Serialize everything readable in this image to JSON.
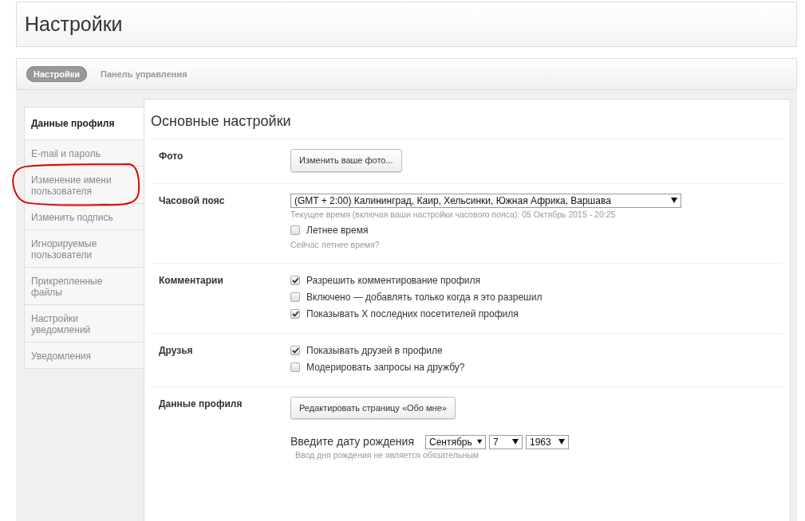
{
  "page_title": "Настройки",
  "tabs": [
    {
      "label": "Настройки",
      "selected": true
    },
    {
      "label": "Панель управления",
      "selected": false
    }
  ],
  "sidebar": {
    "items": [
      {
        "label": "Данные профиля",
        "selected": true
      },
      {
        "label": "E-mail и пароль",
        "selected": false
      },
      {
        "label": "Изменение имени пользователя",
        "selected": false,
        "circled": true
      },
      {
        "label": "Изменить подпись",
        "selected": false
      },
      {
        "label": "Игнорируемые пользователи",
        "selected": false
      },
      {
        "label": "Прикрепленные файлы",
        "selected": false
      },
      {
        "label": "Настройки уведомлений",
        "selected": false
      },
      {
        "label": "Уведомления",
        "selected": false
      }
    ]
  },
  "content": {
    "title": "Основные настройки",
    "sections": [
      {
        "label": "Фото",
        "controls": [
          {
            "kind": "button",
            "label": "Изменить ваше фото..."
          }
        ]
      },
      {
        "label": "Часовой пояс",
        "controls": [
          {
            "kind": "select",
            "value": "(GMT + 2:00) Калининград, Каир, Хельсинки, Южная Африка, Варшава"
          },
          {
            "kind": "hint",
            "text": "Текущее время (включая ваши настройки часового пояса): 05 Октябрь 2015 - 20:25"
          },
          {
            "kind": "checkbox",
            "label": "Летнее время",
            "checked": false
          },
          {
            "kind": "hint",
            "text": "Сейчас летнее время?"
          }
        ]
      },
      {
        "label": "Комментарии",
        "controls": [
          {
            "kind": "checkbox",
            "label": "Разрешить комментирование профиля",
            "checked": true
          },
          {
            "kind": "checkbox",
            "label": "Включено — добавлять только когда я это разрешил",
            "checked": false
          },
          {
            "kind": "checkbox",
            "label": "Показывать X последних посетителей профиля",
            "checked": true
          }
        ]
      },
      {
        "label": "Друзья",
        "controls": [
          {
            "kind": "checkbox",
            "label": "Показывать друзей в профиле",
            "checked": true
          },
          {
            "kind": "checkbox",
            "label": "Модерировать запросы на дружбу?",
            "checked": false
          }
        ]
      },
      {
        "label": "Данные профиля",
        "controls": [
          {
            "kind": "button",
            "label": "Редактировать страницу «Обо мне»"
          },
          {
            "kind": "date",
            "label": "Введите дату рождения",
            "selects": [
              "Сентябрь",
              "7",
              "1963"
            ]
          },
          {
            "kind": "hint",
            "text": "Ввод дня рождения не является обязательным"
          }
        ]
      }
    ]
  }
}
